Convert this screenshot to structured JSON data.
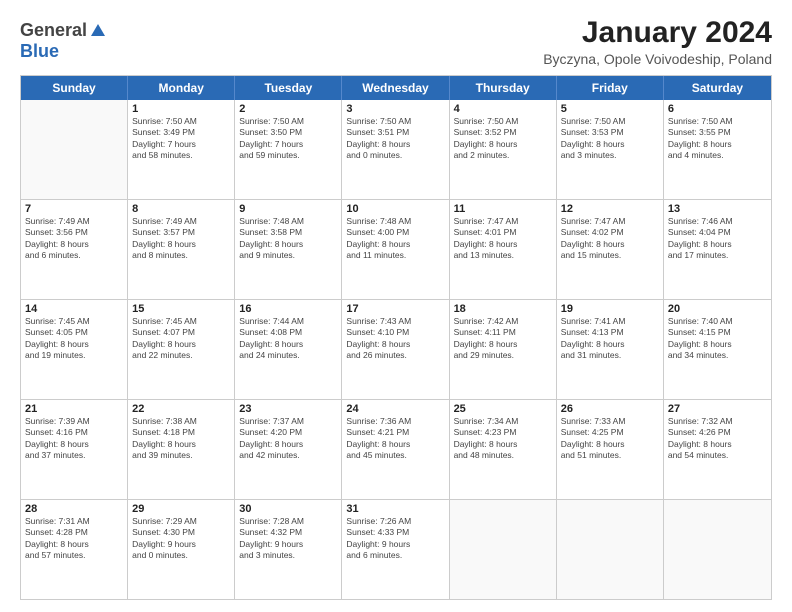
{
  "header": {
    "logo_general": "General",
    "logo_blue": "Blue",
    "title": "January 2024",
    "subtitle": "Byczyna, Opole Voivodeship, Poland"
  },
  "weekdays": [
    "Sunday",
    "Monday",
    "Tuesday",
    "Wednesday",
    "Thursday",
    "Friday",
    "Saturday"
  ],
  "rows": [
    [
      {
        "day": "",
        "info": ""
      },
      {
        "day": "1",
        "info": "Sunrise: 7:50 AM\nSunset: 3:49 PM\nDaylight: 7 hours\nand 58 minutes."
      },
      {
        "day": "2",
        "info": "Sunrise: 7:50 AM\nSunset: 3:50 PM\nDaylight: 7 hours\nand 59 minutes."
      },
      {
        "day": "3",
        "info": "Sunrise: 7:50 AM\nSunset: 3:51 PM\nDaylight: 8 hours\nand 0 minutes."
      },
      {
        "day": "4",
        "info": "Sunrise: 7:50 AM\nSunset: 3:52 PM\nDaylight: 8 hours\nand 2 minutes."
      },
      {
        "day": "5",
        "info": "Sunrise: 7:50 AM\nSunset: 3:53 PM\nDaylight: 8 hours\nand 3 minutes."
      },
      {
        "day": "6",
        "info": "Sunrise: 7:50 AM\nSunset: 3:55 PM\nDaylight: 8 hours\nand 4 minutes."
      }
    ],
    [
      {
        "day": "7",
        "info": "Sunrise: 7:49 AM\nSunset: 3:56 PM\nDaylight: 8 hours\nand 6 minutes."
      },
      {
        "day": "8",
        "info": "Sunrise: 7:49 AM\nSunset: 3:57 PM\nDaylight: 8 hours\nand 8 minutes."
      },
      {
        "day": "9",
        "info": "Sunrise: 7:48 AM\nSunset: 3:58 PM\nDaylight: 8 hours\nand 9 minutes."
      },
      {
        "day": "10",
        "info": "Sunrise: 7:48 AM\nSunset: 4:00 PM\nDaylight: 8 hours\nand 11 minutes."
      },
      {
        "day": "11",
        "info": "Sunrise: 7:47 AM\nSunset: 4:01 PM\nDaylight: 8 hours\nand 13 minutes."
      },
      {
        "day": "12",
        "info": "Sunrise: 7:47 AM\nSunset: 4:02 PM\nDaylight: 8 hours\nand 15 minutes."
      },
      {
        "day": "13",
        "info": "Sunrise: 7:46 AM\nSunset: 4:04 PM\nDaylight: 8 hours\nand 17 minutes."
      }
    ],
    [
      {
        "day": "14",
        "info": "Sunrise: 7:45 AM\nSunset: 4:05 PM\nDaylight: 8 hours\nand 19 minutes."
      },
      {
        "day": "15",
        "info": "Sunrise: 7:45 AM\nSunset: 4:07 PM\nDaylight: 8 hours\nand 22 minutes."
      },
      {
        "day": "16",
        "info": "Sunrise: 7:44 AM\nSunset: 4:08 PM\nDaylight: 8 hours\nand 24 minutes."
      },
      {
        "day": "17",
        "info": "Sunrise: 7:43 AM\nSunset: 4:10 PM\nDaylight: 8 hours\nand 26 minutes."
      },
      {
        "day": "18",
        "info": "Sunrise: 7:42 AM\nSunset: 4:11 PM\nDaylight: 8 hours\nand 29 minutes."
      },
      {
        "day": "19",
        "info": "Sunrise: 7:41 AM\nSunset: 4:13 PM\nDaylight: 8 hours\nand 31 minutes."
      },
      {
        "day": "20",
        "info": "Sunrise: 7:40 AM\nSunset: 4:15 PM\nDaylight: 8 hours\nand 34 minutes."
      }
    ],
    [
      {
        "day": "21",
        "info": "Sunrise: 7:39 AM\nSunset: 4:16 PM\nDaylight: 8 hours\nand 37 minutes."
      },
      {
        "day": "22",
        "info": "Sunrise: 7:38 AM\nSunset: 4:18 PM\nDaylight: 8 hours\nand 39 minutes."
      },
      {
        "day": "23",
        "info": "Sunrise: 7:37 AM\nSunset: 4:20 PM\nDaylight: 8 hours\nand 42 minutes."
      },
      {
        "day": "24",
        "info": "Sunrise: 7:36 AM\nSunset: 4:21 PM\nDaylight: 8 hours\nand 45 minutes."
      },
      {
        "day": "25",
        "info": "Sunrise: 7:34 AM\nSunset: 4:23 PM\nDaylight: 8 hours\nand 48 minutes."
      },
      {
        "day": "26",
        "info": "Sunrise: 7:33 AM\nSunset: 4:25 PM\nDaylight: 8 hours\nand 51 minutes."
      },
      {
        "day": "27",
        "info": "Sunrise: 7:32 AM\nSunset: 4:26 PM\nDaylight: 8 hours\nand 54 minutes."
      }
    ],
    [
      {
        "day": "28",
        "info": "Sunrise: 7:31 AM\nSunset: 4:28 PM\nDaylight: 8 hours\nand 57 minutes."
      },
      {
        "day": "29",
        "info": "Sunrise: 7:29 AM\nSunset: 4:30 PM\nDaylight: 9 hours\nand 0 minutes."
      },
      {
        "day": "30",
        "info": "Sunrise: 7:28 AM\nSunset: 4:32 PM\nDaylight: 9 hours\nand 3 minutes."
      },
      {
        "day": "31",
        "info": "Sunrise: 7:26 AM\nSunset: 4:33 PM\nDaylight: 9 hours\nand 6 minutes."
      },
      {
        "day": "",
        "info": ""
      },
      {
        "day": "",
        "info": ""
      },
      {
        "day": "",
        "info": ""
      }
    ]
  ]
}
